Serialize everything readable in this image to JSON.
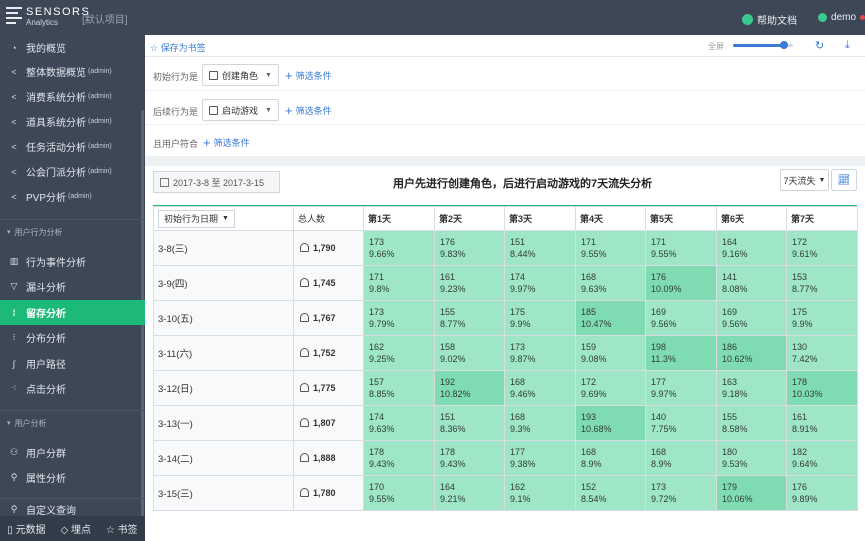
{
  "header": {
    "logo_line1": "SENSORS",
    "logo_line2": "Analytics",
    "project": "[默认项目]",
    "help": "帮助文档",
    "user": "demo"
  },
  "sidebar": {
    "items": [
      {
        "label": "我的概览",
        "admin": "",
        "icon": "dashboard-icon",
        "glyph": "◔"
      },
      {
        "label": "整体数据概览",
        "admin": "(admin)",
        "icon": "share-icon",
        "glyph": "<"
      },
      {
        "label": "消费系统分析",
        "admin": "(admin)",
        "icon": "share-icon",
        "glyph": "<"
      },
      {
        "label": "道具系统分析",
        "admin": "(admin)",
        "icon": "share-icon",
        "glyph": "<"
      },
      {
        "label": "任务活动分析",
        "admin": "(admin)",
        "icon": "share-icon",
        "glyph": "<"
      },
      {
        "label": "公会门派分析",
        "admin": "(admin)",
        "icon": "share-icon",
        "glyph": "<"
      },
      {
        "label": "PVP分析",
        "admin": "(admin)",
        "icon": "share-icon",
        "glyph": "<"
      }
    ],
    "section1": "用户行为分析",
    "behavior_items": [
      {
        "label": "行为事件分析",
        "icon": "bar-chart-icon",
        "glyph": "▥"
      },
      {
        "label": "漏斗分析",
        "icon": "funnel-icon",
        "glyph": "▽"
      },
      {
        "label": "留存分析",
        "icon": "retention-icon",
        "glyph": "⁞"
      },
      {
        "label": "分布分析",
        "icon": "distribution-icon",
        "glyph": "⁝"
      },
      {
        "label": "用户路径",
        "icon": "path-icon",
        "glyph": "∫"
      },
      {
        "label": "点击分析",
        "icon": "click-icon",
        "glyph": "⁖"
      }
    ],
    "section2": "用户分析",
    "user_items": [
      {
        "label": "用户分群",
        "icon": "user-group-icon",
        "glyph": "⚇"
      },
      {
        "label": "属性分析",
        "icon": "attribute-icon",
        "glyph": "⚲"
      }
    ],
    "query_item": {
      "label": "自定义查询",
      "icon": "query-icon",
      "glyph": "⚲"
    },
    "footer": [
      "元数据",
      "埋点",
      "书签"
    ]
  },
  "toolbar": {
    "bookmark": "☆ 保存为书签",
    "zoom_label": "全屏",
    "zoom_level": 0.85
  },
  "filters": {
    "initial_label": "初始行为是",
    "initial_event": "创建角色",
    "add_filter": "筛选条件",
    "followup_label": "后续行为是",
    "followup_event": "启动游戏",
    "user_label": "且用户符合"
  },
  "report": {
    "date_range": "2017-3-8 至 2017-3-15",
    "title": "用户先进行创建角色，后进行启动游戏的7天流失分析",
    "period_select": "7天流失"
  },
  "table": {
    "col_date": "初始行为日期",
    "col_total": "总人数",
    "day_headers": [
      "第1天",
      "第2天",
      "第3天",
      "第4天",
      "第5天",
      "第6天",
      "第7天"
    ],
    "rows": [
      {
        "date": "3-8(三)",
        "total": "1,790",
        "cells": [
          [
            "173",
            "9.66%"
          ],
          [
            "176",
            "9.83%"
          ],
          [
            "151",
            "8.44%"
          ],
          [
            "171",
            "9.55%"
          ],
          [
            "171",
            "9.55%"
          ],
          [
            "164",
            "9.16%"
          ],
          [
            "172",
            "9.61%"
          ]
        ]
      },
      {
        "date": "3-9(四)",
        "total": "1,745",
        "cells": [
          [
            "171",
            "9.8%"
          ],
          [
            "161",
            "9.23%"
          ],
          [
            "174",
            "9.97%"
          ],
          [
            "168",
            "9.63%"
          ],
          [
            "176",
            "10.09%"
          ],
          [
            "141",
            "8.08%"
          ],
          [
            "153",
            "8.77%"
          ]
        ]
      },
      {
        "date": "3-10(五)",
        "total": "1,767",
        "cells": [
          [
            "173",
            "9.79%"
          ],
          [
            "155",
            "8.77%"
          ],
          [
            "175",
            "9.9%"
          ],
          [
            "185",
            "10.47%"
          ],
          [
            "169",
            "9.56%"
          ],
          [
            "169",
            "9.56%"
          ],
          [
            "175",
            "9.9%"
          ]
        ]
      },
      {
        "date": "3-11(六)",
        "total": "1,752",
        "cells": [
          [
            "162",
            "9.25%"
          ],
          [
            "158",
            "9.02%"
          ],
          [
            "173",
            "9.87%"
          ],
          [
            "159",
            "9.08%"
          ],
          [
            "198",
            "11.3%"
          ],
          [
            "186",
            "10.62%"
          ],
          [
            "130",
            "7.42%"
          ]
        ]
      },
      {
        "date": "3-12(日)",
        "total": "1,775",
        "cells": [
          [
            "157",
            "8.85%"
          ],
          [
            "192",
            "10.82%"
          ],
          [
            "168",
            "9.46%"
          ],
          [
            "172",
            "9.69%"
          ],
          [
            "177",
            "9.97%"
          ],
          [
            "163",
            "9.18%"
          ],
          [
            "178",
            "10.03%"
          ]
        ]
      },
      {
        "date": "3-13(一)",
        "total": "1,807",
        "cells": [
          [
            "174",
            "9.63%"
          ],
          [
            "151",
            "8.36%"
          ],
          [
            "168",
            "9.3%"
          ],
          [
            "193",
            "10.68%"
          ],
          [
            "140",
            "7.75%"
          ],
          [
            "155",
            "8.58%"
          ],
          [
            "161",
            "8.91%"
          ]
        ]
      },
      {
        "date": "3-14(二)",
        "total": "1,888",
        "cells": [
          [
            "178",
            "9.43%"
          ],
          [
            "178",
            "9.43%"
          ],
          [
            "177",
            "9.38%"
          ],
          [
            "168",
            "8.9%"
          ],
          [
            "168",
            "8.9%"
          ],
          [
            "180",
            "9.53%"
          ],
          [
            "182",
            "9.64%"
          ]
        ]
      },
      {
        "date": "3-15(三)",
        "total": "1,780",
        "cells": [
          [
            "170",
            "9.55%"
          ],
          [
            "164",
            "9.21%"
          ],
          [
            "162",
            "9.1%"
          ],
          [
            "152",
            "8.54%"
          ],
          [
            "173",
            "9.72%"
          ],
          [
            "179",
            "10.06%"
          ],
          [
            "176",
            "9.89%"
          ]
        ]
      }
    ]
  },
  "colors": {
    "sidebar_bg": "#3d4756",
    "accent_green": "#1db978",
    "cell_green": "#9ee6c6",
    "cell_green_dark": "#7fdcb2",
    "link_blue": "#3a7bd5"
  }
}
